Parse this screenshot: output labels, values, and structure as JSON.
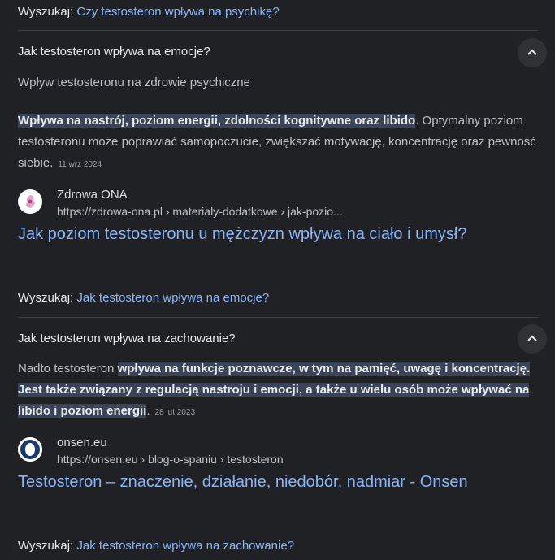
{
  "search_prefix": "Wyszukaj:",
  "top_search": {
    "query": "Czy testosteron wpływa na psychikę?"
  },
  "qa": [
    {
      "question": "Jak testosteron wpływa na emocje?",
      "subheading": "Wpływ testosteronu na zdrowie psychiczne",
      "highlight": "Wpływa na nastrój, poziom energii, zdolności kognitywne oraz libido",
      "rest": ". Optymalny poziom testosteronu może poprawiać samopoczucie, zwiększać motywację, koncentrację oraz pewność siebie.",
      "date": "11 wrz 2024",
      "source": {
        "name": "Zdrowa ONA",
        "url": "https://zdrowa-ona.pl › materialy-dodatkowe › jak-pozio...",
        "title": "Jak poziom testosteronu u mężczyzn wpływa na ciało i umysł?",
        "favicon": "zdrowa-ona-logo-icon"
      },
      "search_query": "Jak testosteron wpływa na emocje?"
    },
    {
      "question": "Jak testosteron wpływa na zachowanie?",
      "pre": "Nadto testosteron ",
      "highlight": "wpływa na funkcje poznawcze, w tym na pamięć, uwagę i koncentrację. Jest także związany z regulacją nastroju i emocji, a także u wielu osób może wpływać na libido i poziom energii",
      "rest": ".",
      "date": "28 lut 2023",
      "source": {
        "name": "onsen.eu",
        "url": "https://onsen.eu › blog-o-spaniu › testosteron",
        "title": "Testosteron – znaczenie, działanie, niedobór, nadmiar - Onsen",
        "favicon": "onsen-logo-icon"
      },
      "search_query": "Jak testosteron wpływa na zachowanie?"
    }
  ],
  "colors": {
    "background": "#202124",
    "link": "#8ab4f8",
    "highlight_bg": "#394457"
  }
}
